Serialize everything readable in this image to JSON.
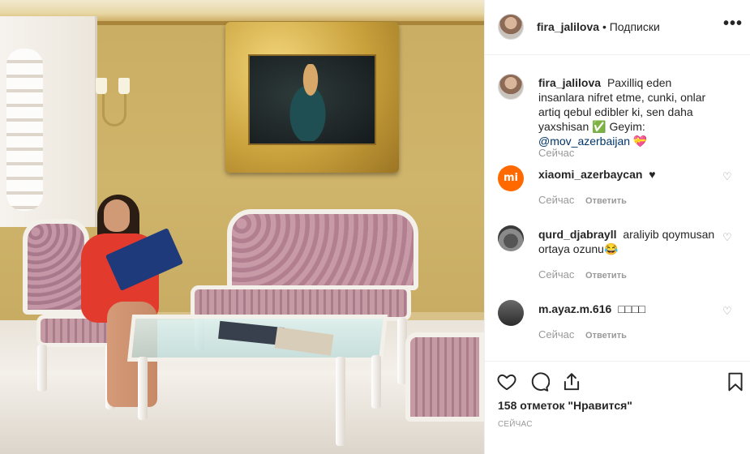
{
  "header": {
    "username": "fira_jalilova",
    "separator": "•",
    "follow_label": "Подписки",
    "more_label": "•••"
  },
  "caption": {
    "username": "fira_jalilova",
    "text": "Paxilliq eden insanlara nifret etme, cunki, onlar artiq qebul edibler ki, sen daha yaxshisan ✅ Geyim: ",
    "mention": "@mov_azerbaijan",
    "trailing": " 💝",
    "time": "Сейчас"
  },
  "comments": [
    {
      "username": "xiaomi_azerbaycan",
      "text": "♥",
      "time": "Сейчас",
      "reply_label": "Ответить",
      "avatar_text": "mi"
    },
    {
      "username": "qurd_djabrayll",
      "text": "araliyib qoymusan ortaya ozunu😂",
      "time": "Сейчас",
      "reply_label": "Ответить"
    },
    {
      "username": "m.ayaz.m.616",
      "text": "□□□□",
      "time": "Сейчас",
      "reply_label": "Ответить"
    }
  ],
  "footer": {
    "likes": "158 отметок \"Нравится\"",
    "time": "СЕЙЧАС"
  },
  "icons": [
    "heart-icon",
    "comment-icon",
    "share-icon",
    "bookmark-icon",
    "more-icon"
  ]
}
